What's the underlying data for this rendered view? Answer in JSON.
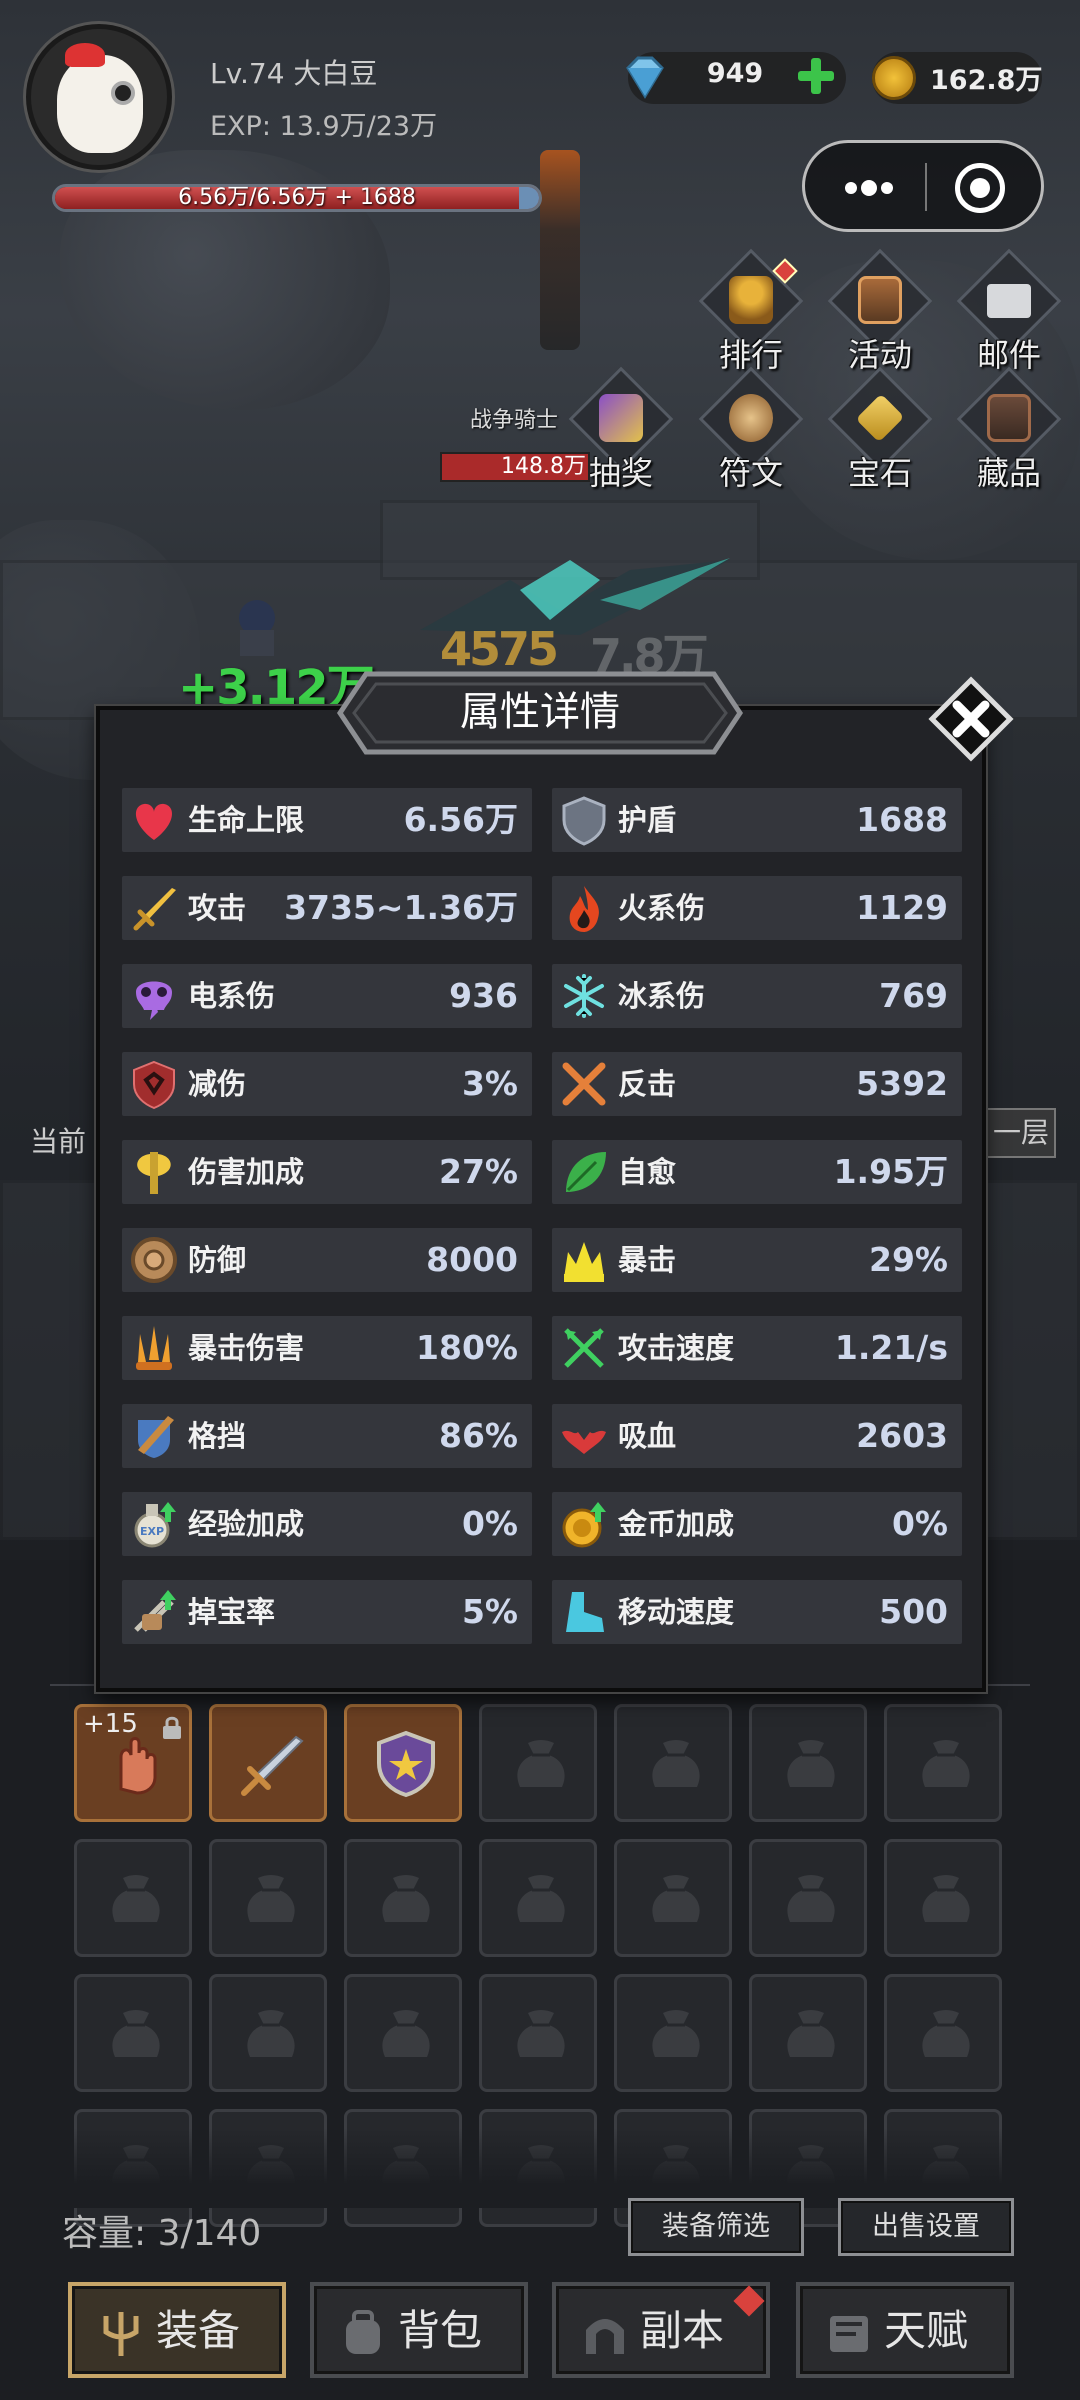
{
  "player": {
    "level_name": "Lv.74 大白豆",
    "exp": "EXP: 13.9万/23万",
    "hp_text": "6.56万/6.56万 + 1688",
    "hp_fraction": 1.0
  },
  "currency": {
    "gems": "949",
    "coins": "162.8万"
  },
  "menu": {
    "row1": [
      {
        "label": "排行",
        "icon": "trophy-icon",
        "badge": true
      },
      {
        "label": "活动",
        "icon": "treasure-chest-icon"
      },
      {
        "label": "邮件",
        "icon": "envelope-icon"
      }
    ],
    "row2": [
      {
        "label": "抽奖",
        "icon": "gift-box-icon"
      },
      {
        "label": "符文",
        "icon": "rune-icon"
      },
      {
        "label": "宝石",
        "icon": "gem-icon"
      },
      {
        "label": "藏品",
        "icon": "collection-chest-icon"
      }
    ]
  },
  "battle": {
    "enemy_name": "战争骑士",
    "enemy_hp": "148.8万",
    "heal_number": "+3.12万",
    "damage_number": "4575",
    "damage_number_2": "7.8万",
    "current_floor_label": "当前",
    "next_floor_label": "一层"
  },
  "dialog": {
    "title": "属性详情",
    "colors": {
      "bg": "#222327",
      "row": "#34363c",
      "value": "#cfd8ec"
    },
    "stats": [
      {
        "name": "生命上限",
        "value": "6.56万",
        "icon": "heart-icon"
      },
      {
        "name": "护盾",
        "value": "1688",
        "icon": "shield-icon"
      },
      {
        "name": "攻击",
        "value": "3735~1.36万",
        "icon": "sword-icon"
      },
      {
        "name": "火系伤",
        "value": "1129",
        "icon": "fire-icon"
      },
      {
        "name": "电系伤",
        "value": "936",
        "icon": "lightning-skull-icon"
      },
      {
        "name": "冰系伤",
        "value": "769",
        "icon": "snowflake-icon"
      },
      {
        "name": "减伤",
        "value": "3%",
        "icon": "damage-reduction-shield-icon"
      },
      {
        "name": "反击",
        "value": "5392",
        "icon": "crossed-swords-icon"
      },
      {
        "name": "伤害加成",
        "value": "27%",
        "icon": "axe-icon"
      },
      {
        "name": "自愈",
        "value": "1.95万",
        "icon": "leaf-icon"
      },
      {
        "name": "防御",
        "value": "8000",
        "icon": "round-shield-icon"
      },
      {
        "name": "暴击",
        "value": "29%",
        "icon": "crit-burst-icon"
      },
      {
        "name": "暴击伤害",
        "value": "180%",
        "icon": "triple-blade-icon"
      },
      {
        "name": "攻击速度",
        "value": "1.21/s",
        "icon": "crossed-arrows-icon"
      },
      {
        "name": "格挡",
        "value": "86%",
        "icon": "block-sword-shield-icon"
      },
      {
        "name": "吸血",
        "value": "2603",
        "icon": "bat-icon"
      },
      {
        "name": "经验加成",
        "value": "0%",
        "icon": "exp-potion-icon"
      },
      {
        "name": "金币加成",
        "value": "0%",
        "icon": "gold-coin-up-icon"
      },
      {
        "name": "掉宝率",
        "value": "5%",
        "icon": "loot-drop-icon"
      },
      {
        "name": "移动速度",
        "value": "500",
        "icon": "boot-icon"
      }
    ]
  },
  "bag": {
    "equipped": [
      {
        "icon": "gauntlet-icon",
        "enhance": "+15",
        "locked": true
      },
      {
        "icon": "sword-icon"
      },
      {
        "icon": "star-shield-icon"
      }
    ],
    "capacity": "容量: 3/140",
    "filter_button": "装备筛选",
    "sell_button": "出售设置"
  },
  "tabs": [
    {
      "label": "装备",
      "icon": "trident-icon",
      "active": true
    },
    {
      "label": "背包",
      "icon": "backpack-icon"
    },
    {
      "label": "副本",
      "icon": "dungeon-gate-icon",
      "badge": true
    },
    {
      "label": "天赋",
      "icon": "book-icon"
    }
  ]
}
